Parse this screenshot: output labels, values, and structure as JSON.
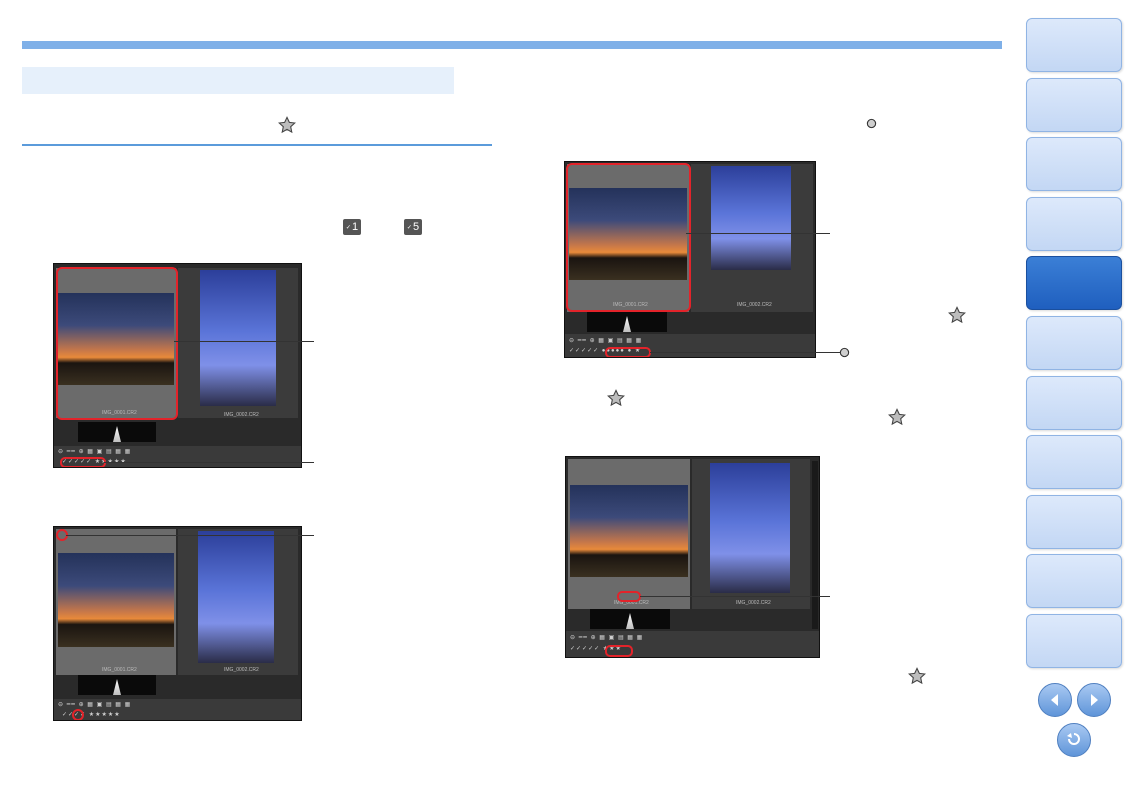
{
  "page": {
    "accent_color": "#7fb0e8",
    "section_bg": "#e6f0fb",
    "highlight_color": "#e3232a"
  },
  "icons": {
    "rating_star": "star-icon",
    "check_badges": [
      "check-mark-1-icon",
      "check-mark-5-icon"
    ],
    "rating_dot": "dot-icon"
  },
  "badges": {
    "check_first": "1",
    "check_last": "5"
  },
  "screens": {
    "file_name_a": "IMG_0001.CR2",
    "file_name_b": "IMG_0002.CR2"
  },
  "sidebar": {
    "tabs": [
      "",
      "",
      "",
      "",
      "",
      "",
      "",
      "",
      "",
      "",
      ""
    ],
    "active_index": 4
  },
  "nav": {
    "prev": "previous-page-icon",
    "next": "next-page-icon",
    "back": "return-icon"
  }
}
